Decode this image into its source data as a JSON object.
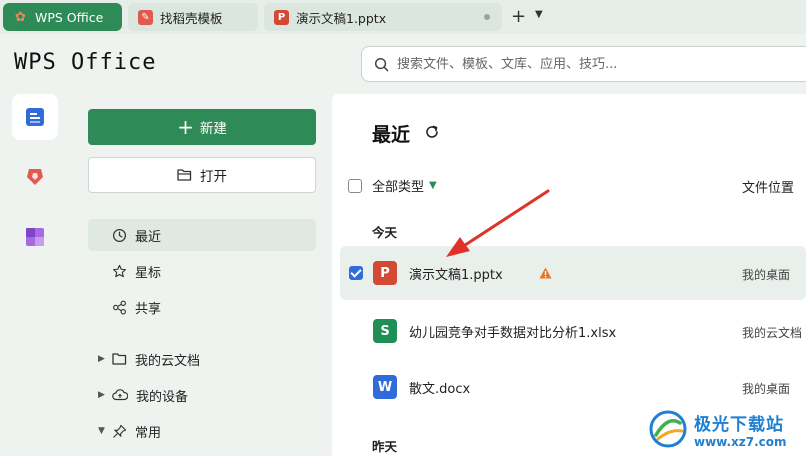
{
  "tabs": [
    {
      "label": "WPS Office"
    },
    {
      "label": "找稻壳模板"
    },
    {
      "label": "演示文稿1.pptx"
    }
  ],
  "header": {
    "logo": "WPS Office",
    "search_placeholder": "搜索文件、模板、文库、应用、技巧..."
  },
  "sidebar": {
    "new_label": "新建",
    "open_label": "打开",
    "nav": [
      {
        "label": "最近"
      },
      {
        "label": "星标"
      },
      {
        "label": "共享"
      },
      {
        "label": "我的云文档"
      },
      {
        "label": "我的设备"
      },
      {
        "label": "常用"
      }
    ]
  },
  "main": {
    "title": "最近",
    "filter_label": "全部类型",
    "col_location": "文件位置",
    "groups": [
      "今天",
      "昨天"
    ],
    "files": [
      {
        "type": "P",
        "name": "演示文稿1.pptx",
        "location": "我的桌面",
        "selected": true
      },
      {
        "type": "S",
        "name": "幼儿园竞争对手数据对比分析1.xlsx",
        "location": "我的云文档"
      },
      {
        "type": "W",
        "name": "散文.docx",
        "location": "我的桌面"
      }
    ]
  },
  "watermark": {
    "title": "极光下载站",
    "url": "www.xz7.com"
  },
  "colors": {
    "brand_green": "#2e8b57",
    "ppt_red": "#d24a33",
    "xls_green": "#1f8f56",
    "doc_blue": "#2f6bd9",
    "arrow_red": "#e0322b"
  }
}
